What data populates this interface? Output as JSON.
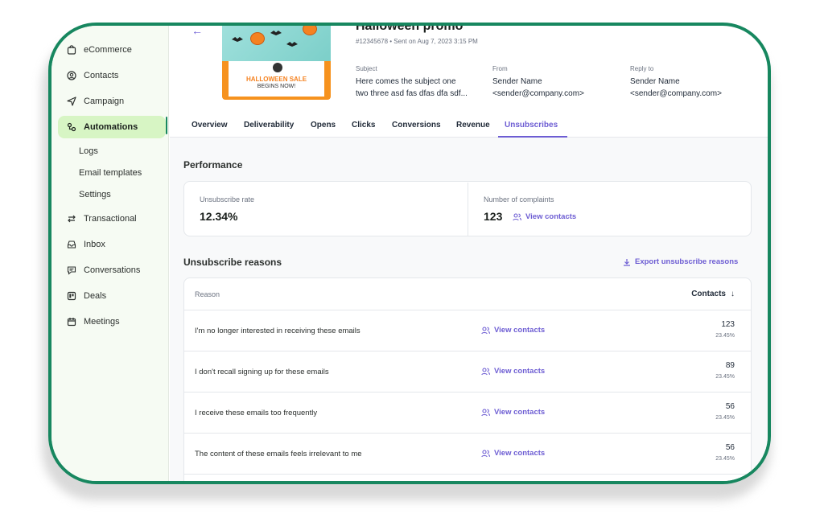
{
  "sidebar": {
    "items": [
      {
        "label": "eCommerce",
        "icon": "shopping-bag-icon"
      },
      {
        "label": "Contacts",
        "icon": "contacts-icon"
      },
      {
        "label": "Campaign",
        "icon": "send-icon"
      },
      {
        "label": "Automations",
        "icon": "automation-icon",
        "active": true
      },
      {
        "label": "Transactional",
        "icon": "arrows-icon"
      },
      {
        "label": "Inbox",
        "icon": "inbox-icon"
      },
      {
        "label": "Conversations",
        "icon": "chat-icon"
      },
      {
        "label": "Deals",
        "icon": "deals-icon"
      },
      {
        "label": "Meetings",
        "icon": "calendar-icon"
      }
    ],
    "subitems": [
      "Logs",
      "Email templates",
      "Settings"
    ]
  },
  "header": {
    "title": "Halloween promo",
    "meta": "#12345678 • Sent on Aug 7, 2023 3:15 PM",
    "thumbnail": {
      "sale": "HALLOWEEN SALE",
      "begins": "BEGINS NOW!"
    },
    "subject_label": "Subject",
    "subject_value_1": "Here comes the subject one",
    "subject_value_2": "two three asd fas dfas dfa sdf...",
    "from_label": "From",
    "from_name": "Sender Name",
    "from_email": "<sender@company.com>",
    "reply_label": "Reply to",
    "reply_name": "Sender Name",
    "reply_email": "<sender@company.com>"
  },
  "tabs": [
    "Overview",
    "Deliverability",
    "Opens",
    "Clicks",
    "Conversions",
    "Revenue",
    "Unsubscribes"
  ],
  "active_tab": "Unsubscribes",
  "performance": {
    "heading": "Performance",
    "unsub_rate_label": "Unsubscribe rate",
    "unsub_rate_value": "12.34%",
    "complaints_label": "Number of complaints",
    "complaints_value": "123",
    "view_contacts": "View contacts"
  },
  "reasons": {
    "heading": "Unsubscribe reasons",
    "export_label": "Export unsubscribe reasons",
    "col_reason": "Reason",
    "col_contacts": "Contacts",
    "view_contacts": "View contacts",
    "rows": [
      {
        "reason": "I'm no longer interested in receiving these emails",
        "count": "123",
        "pct": "23.45%"
      },
      {
        "reason": "I don't recall signing up for these emails",
        "count": "89",
        "pct": "23.45%"
      },
      {
        "reason": "I receive these emails too frequently",
        "count": "56",
        "pct": "23.45%"
      },
      {
        "reason": "The content of these emails feels irrelevant to me",
        "count": "56",
        "pct": "23.45%"
      }
    ]
  },
  "colors": {
    "accent": "#6d5dd3",
    "brand_green": "#17875f",
    "active_nav": "#d7f5c4"
  }
}
